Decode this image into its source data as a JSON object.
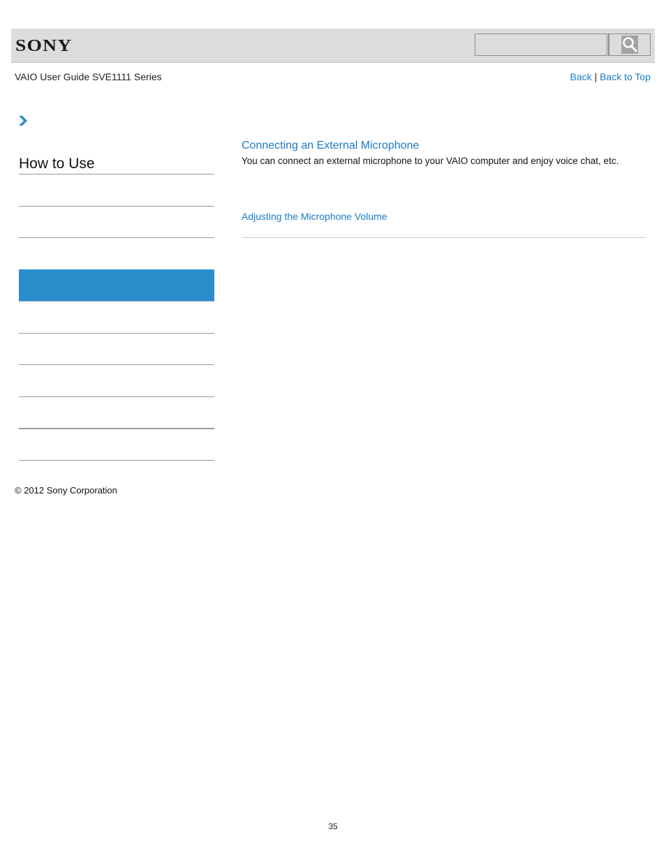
{
  "header": {
    "logo": "SONY",
    "search": {
      "value": "",
      "placeholder": "",
      "button_icon": "search-icon"
    }
  },
  "subheader": {
    "doc_title": "VAIO User Guide SVE1111 Series",
    "links": {
      "back": "Back",
      "separator": "|",
      "back_to_top": "Back to Top"
    }
  },
  "breadcrumb": {
    "icon": "chevron-right-icon"
  },
  "sidebar": {
    "title": "How to Use",
    "items": [
      {
        "label": "",
        "active": false
      },
      {
        "label": "",
        "active": false
      },
      {
        "label": "",
        "active": false
      },
      {
        "label": "",
        "active": true
      },
      {
        "label": "",
        "active": false
      },
      {
        "label": "",
        "active": false
      },
      {
        "label": "",
        "active": false
      },
      {
        "label": "",
        "active": false
      },
      {
        "label": "",
        "active": false
      }
    ]
  },
  "main": {
    "topic_title": "Connecting an External Microphone",
    "topic_description": "You can connect an external microphone to your VAIO computer and enjoy voice chat, etc.",
    "related_link": "Adjusting the Microphone Volume"
  },
  "footer": {
    "copyright": "© 2012 Sony Corporation",
    "page_number": "35"
  },
  "colors": {
    "accent": "#1a7bc4",
    "active_nav": "#2a8dcc",
    "header_bg": "#dcdcdc"
  }
}
